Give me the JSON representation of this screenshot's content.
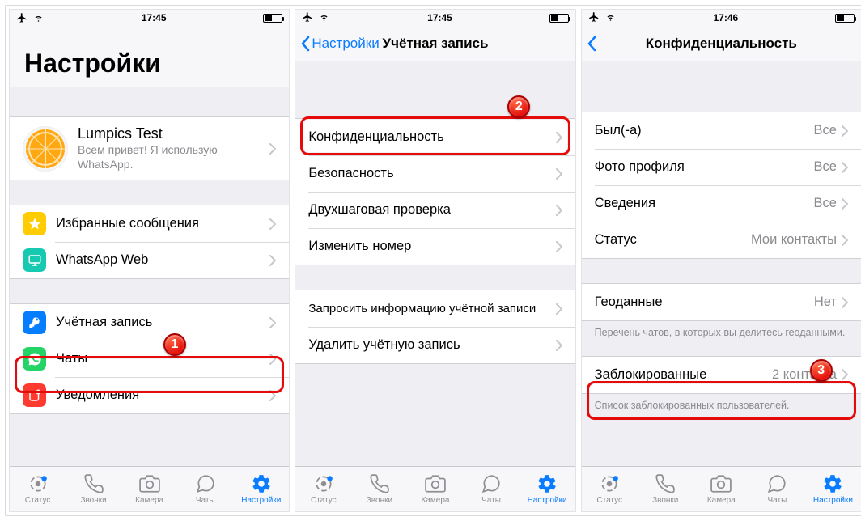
{
  "status": {
    "time_a": "17:45",
    "time_b": "17:45",
    "time_c": "17:46"
  },
  "screen1": {
    "title": "Настройки",
    "profile": {
      "name": "Lumpics Test",
      "status": "Всем привет! Я использую WhatsApp."
    },
    "items": {
      "starred": "Избранные сообщения",
      "web": "WhatsApp Web",
      "account": "Учётная запись",
      "chats": "Чаты",
      "notifications": "Уведомления"
    }
  },
  "screen2": {
    "back": "Настройки",
    "title": "Учётная запись",
    "items": {
      "privacy": "Конфиденциальность",
      "security": "Безопасность",
      "twostep": "Двухшаговая проверка",
      "changenum": "Изменить номер",
      "request": "Запросить информацию учётной записи",
      "delete": "Удалить учётную запись"
    }
  },
  "screen3": {
    "title": "Конфиденциальность",
    "items": {
      "lastseen": {
        "label": "Был(-а)",
        "value": "Все"
      },
      "photo": {
        "label": "Фото профиля",
        "value": "Все"
      },
      "about": {
        "label": "Сведения",
        "value": "Все"
      },
      "status": {
        "label": "Статус",
        "value": "Мои контакты"
      },
      "live": {
        "label": "Геоданные",
        "value": "Нет"
      },
      "live_footer": "Перечень чатов, в которых вы делитесь геоданными.",
      "blocked": {
        "label": "Заблокированные",
        "value": "2 контакта"
      },
      "blocked_footer": "Список заблокированных пользователей."
    }
  },
  "tabs": {
    "status": "Статус",
    "calls": "Звонки",
    "camera": "Камера",
    "chats": "Чаты",
    "settings": "Настройки"
  },
  "badges": {
    "one": "1",
    "two": "2",
    "three": "3"
  }
}
